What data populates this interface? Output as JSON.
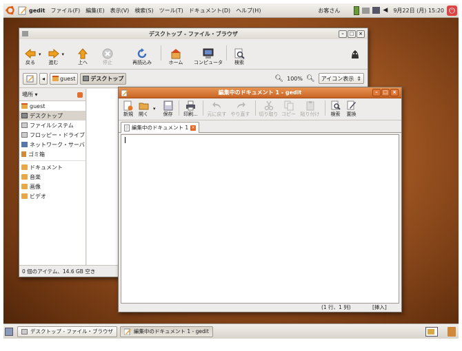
{
  "top_panel": {
    "app_name": "gedit",
    "menus": [
      "ファイル(F)",
      "編集(E)",
      "表示(V)",
      "検索(S)",
      "ツール(T)",
      "ドキュメント(D)",
      "ヘルプ(H)"
    ],
    "user": "お客さん",
    "datetime": "9月22日 (月) 15:20"
  },
  "file_browser": {
    "title": "デスクトップ - ファイル・ブラウザ",
    "toolbar": {
      "back": "戻る",
      "forward": "進む",
      "up": "上へ",
      "stop": "停止",
      "reload": "再読込み",
      "home": "ホーム",
      "computer": "コンピュータ",
      "search": "検索"
    },
    "location": {
      "crumb_1": "guest",
      "crumb_2": "デスクトップ",
      "zoom": "100%",
      "view_mode": "アイコン表示"
    },
    "sidebar": {
      "header": "場所 ▾",
      "places": [
        {
          "icon": "home-folder-icon",
          "label": "guest"
        },
        {
          "icon": "desktop-icon",
          "label": "デスクトップ"
        },
        {
          "icon": "filesystem-icon",
          "label": "ファイルシステム"
        },
        {
          "icon": "floppy-icon",
          "label": "フロッピー・ドライブ"
        },
        {
          "icon": "network-icon",
          "label": "ネットワーク・サーバ"
        },
        {
          "icon": "trash-icon",
          "label": "ゴミ箱"
        }
      ],
      "bookmarks": [
        {
          "icon": "folder-icon",
          "label": "ドキュメント"
        },
        {
          "icon": "folder-icon",
          "label": "音楽"
        },
        {
          "icon": "folder-icon",
          "label": "画像"
        },
        {
          "icon": "folder-icon",
          "label": "ビデオ"
        }
      ]
    },
    "status": "0 個のアイテム、14.6 GB 空き"
  },
  "gedit": {
    "title": "編集中のドキュメント 1 - gedit",
    "toolbar": {
      "new": "新規",
      "open": "開く",
      "save": "保存",
      "print": "印刷...",
      "undo": "元に戻す",
      "redo": "やり直す",
      "cut": "切り取り",
      "copy": "コピー",
      "paste": "貼り付け",
      "find": "検索",
      "replace": "置換"
    },
    "tab_label": "編集中のドキュメント 1",
    "status_position": "(1 行、1 列)",
    "status_mode": "[挿入]"
  },
  "bottom_panel": {
    "task_1": "デスクトップ - ファイル・ブラウザ",
    "task_2": "編集中のドキュメント 1 - gedit"
  }
}
